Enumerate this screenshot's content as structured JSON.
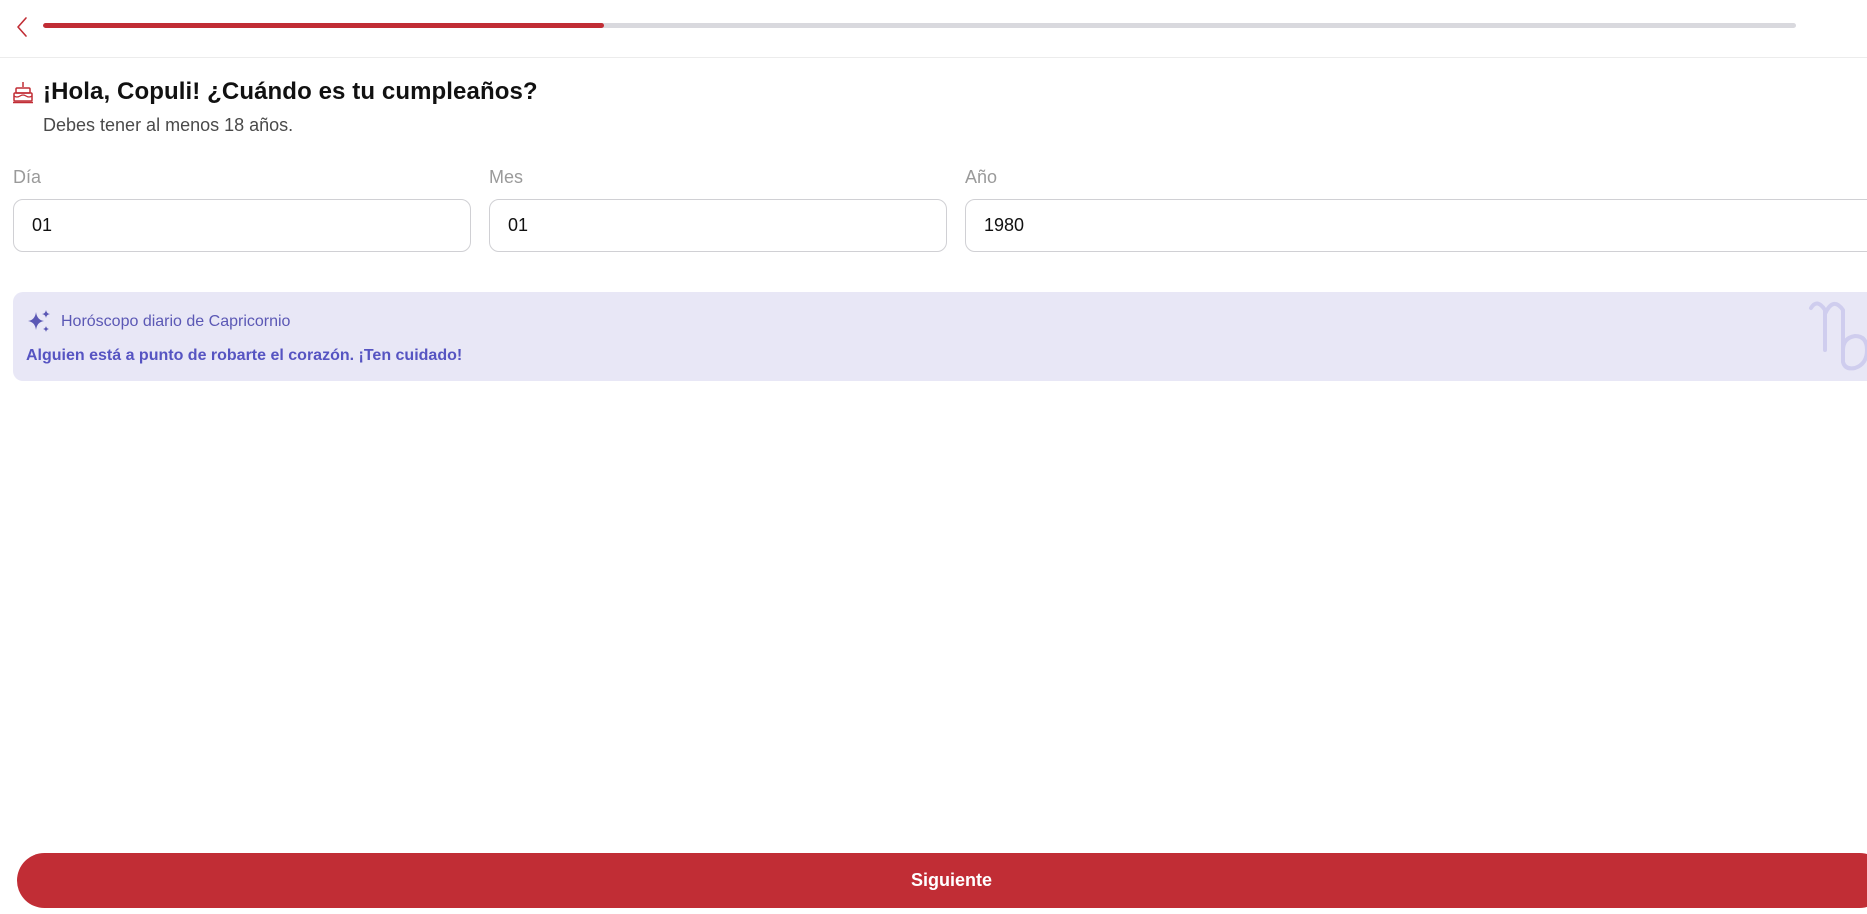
{
  "header": {
    "back_icon": "chevron-left-icon",
    "progress_fraction": 0.32,
    "accent_color": "#c12d35"
  },
  "main": {
    "title_icon": "birthday-cake-icon",
    "title": "¡Hola, Copuli! ¿Cuándo es tu cumpleaños?",
    "subtitle": "Debes tener al menos 18 años."
  },
  "form": {
    "day": {
      "label": "Día",
      "value": "01"
    },
    "month": {
      "label": "Mes",
      "value": "01"
    },
    "year": {
      "label": "Año",
      "value": "1980"
    }
  },
  "horoscope": {
    "icon": "sparkle-icon",
    "label": "Horóscopo diario de Capricornio",
    "message": "Alguien está a punto de robarte el corazón. ¡Ten cuidado!",
    "zodiac_icon": "capricorn-icon",
    "background_color": "#e8e7f6",
    "text_color": "#5654c2"
  },
  "footer": {
    "next_label": "Siguiente"
  }
}
